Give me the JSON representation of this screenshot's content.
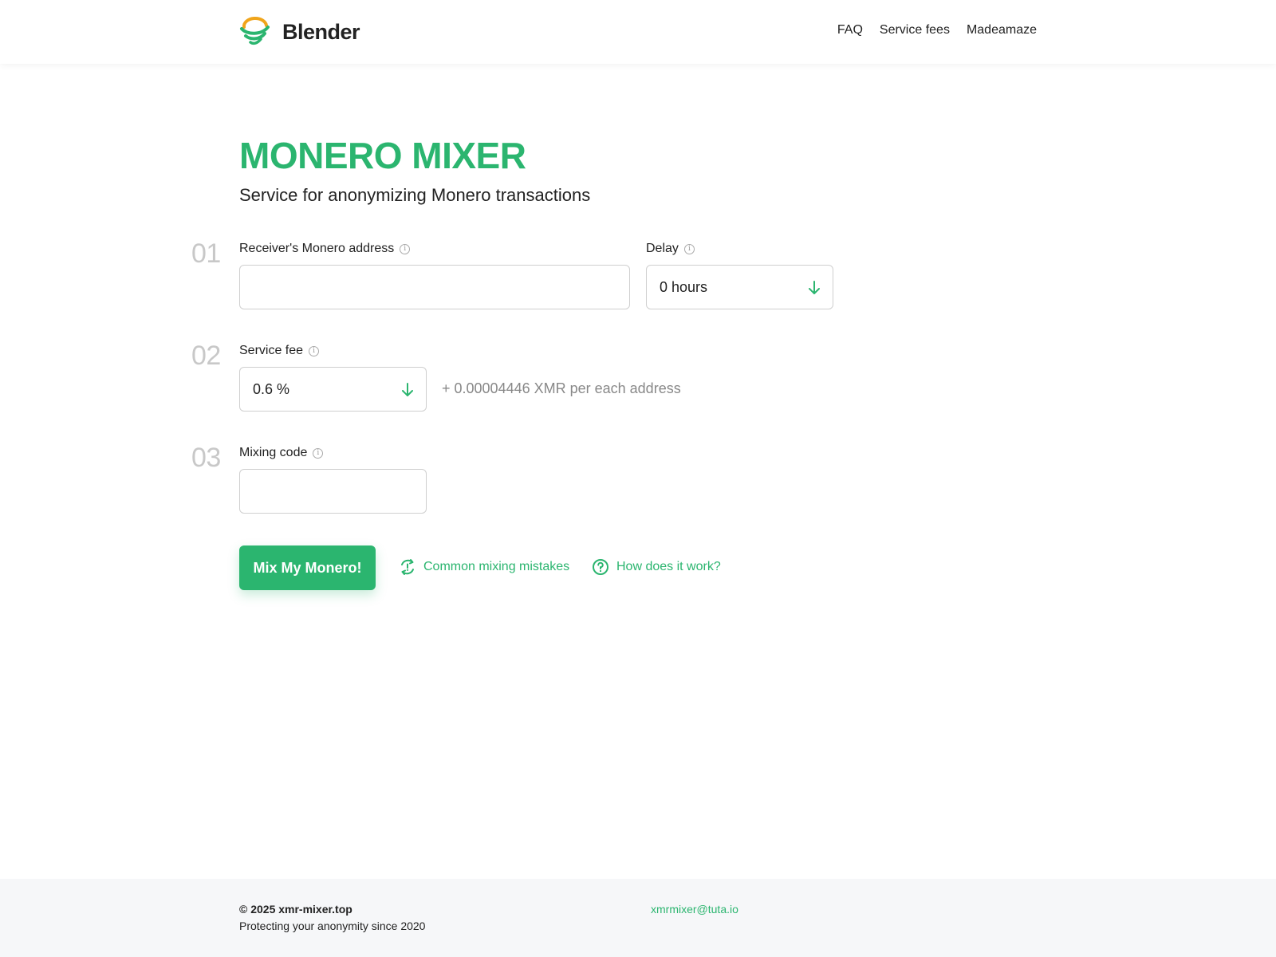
{
  "header": {
    "brand": "Blender",
    "logo_icon": "tornado-logo-icon",
    "nav": [
      {
        "label": "FAQ"
      },
      {
        "label": "Service fees"
      },
      {
        "label": "Madeamaze"
      }
    ]
  },
  "hero": {
    "title": "MONERO MIXER",
    "subtitle": "Service for anonymizing Monero transactions"
  },
  "form": {
    "step1": {
      "number": "01",
      "address_label": "Receiver's Monero address",
      "address_value": "",
      "delay_label": "Delay",
      "delay_value": "0 hours"
    },
    "step2": {
      "number": "02",
      "fee_label": "Service fee",
      "fee_value": "0.6 %",
      "fee_note": "+ 0.00004446 XMR per each address"
    },
    "step3": {
      "number": "03",
      "code_label": "Mixing code",
      "code_value": ""
    },
    "submit_label": "Mix My Monero!",
    "links": {
      "mistakes": "Common mixing mistakes",
      "how": "How does it work?"
    }
  },
  "footer": {
    "copyright": "© 2025 xmr-mixer.top",
    "tagline": "Protecting your anonymity since 2020",
    "email": "xmrmixer@tuta.io"
  },
  "colors": {
    "accent": "#2bb56f",
    "logo_orange": "#f0a51c",
    "text": "#222222",
    "muted": "#888888",
    "footer_bg": "#f6f7f9"
  }
}
